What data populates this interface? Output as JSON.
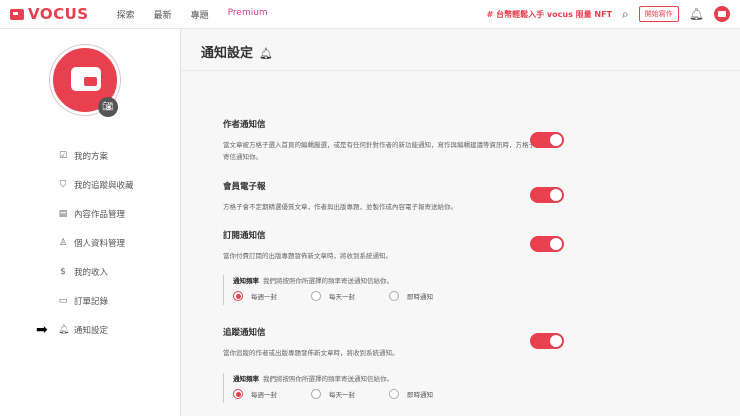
{
  "header": {
    "logo": "VOCUS",
    "nav": [
      "探索",
      "最新",
      "專題",
      "Premium"
    ],
    "promo": "# 台幣輕鬆入手 vocus 限量 NFT",
    "write_button": "開始寫作"
  },
  "sidebar": {
    "items": [
      {
        "label": "我的方案",
        "icon": "☑"
      },
      {
        "label": "我的追蹤與收藏",
        "icon": "⛉"
      },
      {
        "label": "內容作品管理",
        "icon": "▤"
      },
      {
        "label": "個人資料管理",
        "icon": "♙"
      },
      {
        "label": "我的收入",
        "icon": "$"
      },
      {
        "label": "訂單記錄",
        "icon": "▭"
      },
      {
        "label": "通知設定",
        "icon": "🔔︎"
      }
    ],
    "active": "通知設定"
  },
  "main": {
    "title": "通知設定",
    "sections": [
      {
        "title": "作者通知信",
        "desc": "當文章被方格子選入首頁的編輯嚴選，或是有任何針對作者的新功能通知，寫作與編輯建議等資訊時，方格子會寄信通知你。",
        "enabled": true
      },
      {
        "title": "會員電子報",
        "desc": "方格子會不定期精選優質文章，作者與出版專題，並製作成內容電子報寄送給你。",
        "enabled": true
      },
      {
        "title": "訂閱通知信",
        "desc": "當你付費訂閱的出版專題發佈新文章時，將收到系統通知。",
        "enabled": true
      },
      {
        "title": "追蹤通知信",
        "desc": "當你追蹤的作者或出版專題發佈新文章時，將收到系統通知。",
        "enabled": true
      }
    ],
    "frequency": {
      "label": "通知頻率",
      "hint": "我們將按照你所選擇的頻率寄送通知信給你。",
      "options": [
        "每週一封",
        "每天一封",
        "即時通知"
      ],
      "selected_subscribe": "每週一封",
      "selected_follow": "每週一封"
    }
  },
  "colors": {
    "accent": "#e8404f"
  }
}
